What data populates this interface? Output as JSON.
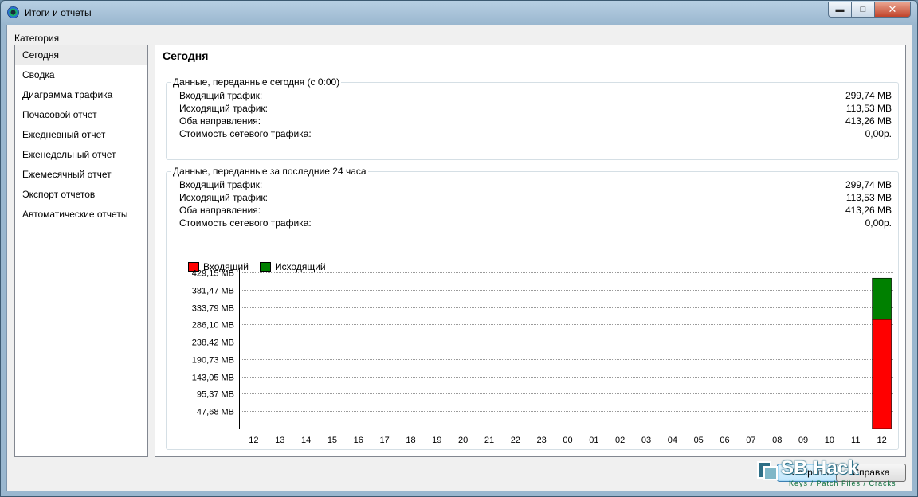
{
  "window": {
    "title": "Итоги и отчеты"
  },
  "category_label": "Категория",
  "sidebar": {
    "items": [
      {
        "label": "Сегодня",
        "selected": true
      },
      {
        "label": "Сводка"
      },
      {
        "label": "Диаграмма трафика"
      },
      {
        "label": "Почасовой отчет"
      },
      {
        "label": "Ежедневный отчет"
      },
      {
        "label": "Еженедельный отчет"
      },
      {
        "label": "Ежемесячный отчет"
      },
      {
        "label": "Экспорт отчетов"
      },
      {
        "label": "Автоматические отчеты"
      }
    ]
  },
  "main": {
    "title": "Сегодня",
    "today": {
      "title": "Данные, переданные сегодня (с 0:00)",
      "rows": [
        {
          "label": "Входящий трафик:",
          "value": "299,74 MB"
        },
        {
          "label": "Исходящий трафик:",
          "value": "113,53 MB"
        },
        {
          "label": "Оба направления:",
          "value": "413,26 MB"
        },
        {
          "label": "Стоимость сетевого трафика:",
          "value": "0,00р."
        }
      ]
    },
    "last24": {
      "title": "Данные, переданные за последние 24 часа",
      "rows": [
        {
          "label": "Входящий трафик:",
          "value": "299,74 MB"
        },
        {
          "label": "Исходящий трафик:",
          "value": "113,53 MB"
        },
        {
          "label": "Оба направления:",
          "value": "413,26 MB"
        },
        {
          "label": "Стоимость сетевого трафика:",
          "value": "0,00р."
        }
      ]
    }
  },
  "chart_data": {
    "type": "bar",
    "stacked": true,
    "categories": [
      "12",
      "13",
      "14",
      "15",
      "16",
      "17",
      "18",
      "19",
      "20",
      "21",
      "22",
      "23",
      "00",
      "01",
      "02",
      "03",
      "04",
      "05",
      "06",
      "07",
      "08",
      "09",
      "10",
      "11",
      "12"
    ],
    "series": [
      {
        "name": "Входящий",
        "color": "#ff0000",
        "values": [
          0,
          0,
          0,
          0,
          0,
          0,
          0,
          0,
          0,
          0,
          0,
          0,
          0,
          0,
          0,
          0,
          0,
          0,
          0,
          0,
          0,
          0,
          0,
          0,
          299.74
        ]
      },
      {
        "name": "Исходящий",
        "color": "#008000",
        "values": [
          0,
          0,
          0,
          0,
          0,
          0,
          0,
          0,
          0,
          0,
          0,
          0,
          0,
          0,
          0,
          0,
          0,
          0,
          0,
          0,
          0,
          0,
          0,
          0,
          113.53
        ]
      }
    ],
    "yticks": [
      {
        "label": "47,68 MB",
        "value": 47.68
      },
      {
        "label": "95,37 MB",
        "value": 95.37
      },
      {
        "label": "143,05 MB",
        "value": 143.05
      },
      {
        "label": "190,73 MB",
        "value": 190.73
      },
      {
        "label": "238,42 MB",
        "value": 238.42
      },
      {
        "label": "286,10 MB",
        "value": 286.1
      },
      {
        "label": "333,79 MB",
        "value": 333.79
      },
      {
        "label": "381,47 MB",
        "value": 381.47
      },
      {
        "label": "429,15 MB",
        "value": 429.15
      }
    ],
    "ylim": [
      0,
      429.15
    ],
    "legend_position": "top-left",
    "grid": true
  },
  "buttons": {
    "close": "Закрыть",
    "help": "Справка"
  },
  "watermark": {
    "brand": "SB Hack",
    "tagline": "Keys / Patch Files / Cracks"
  }
}
